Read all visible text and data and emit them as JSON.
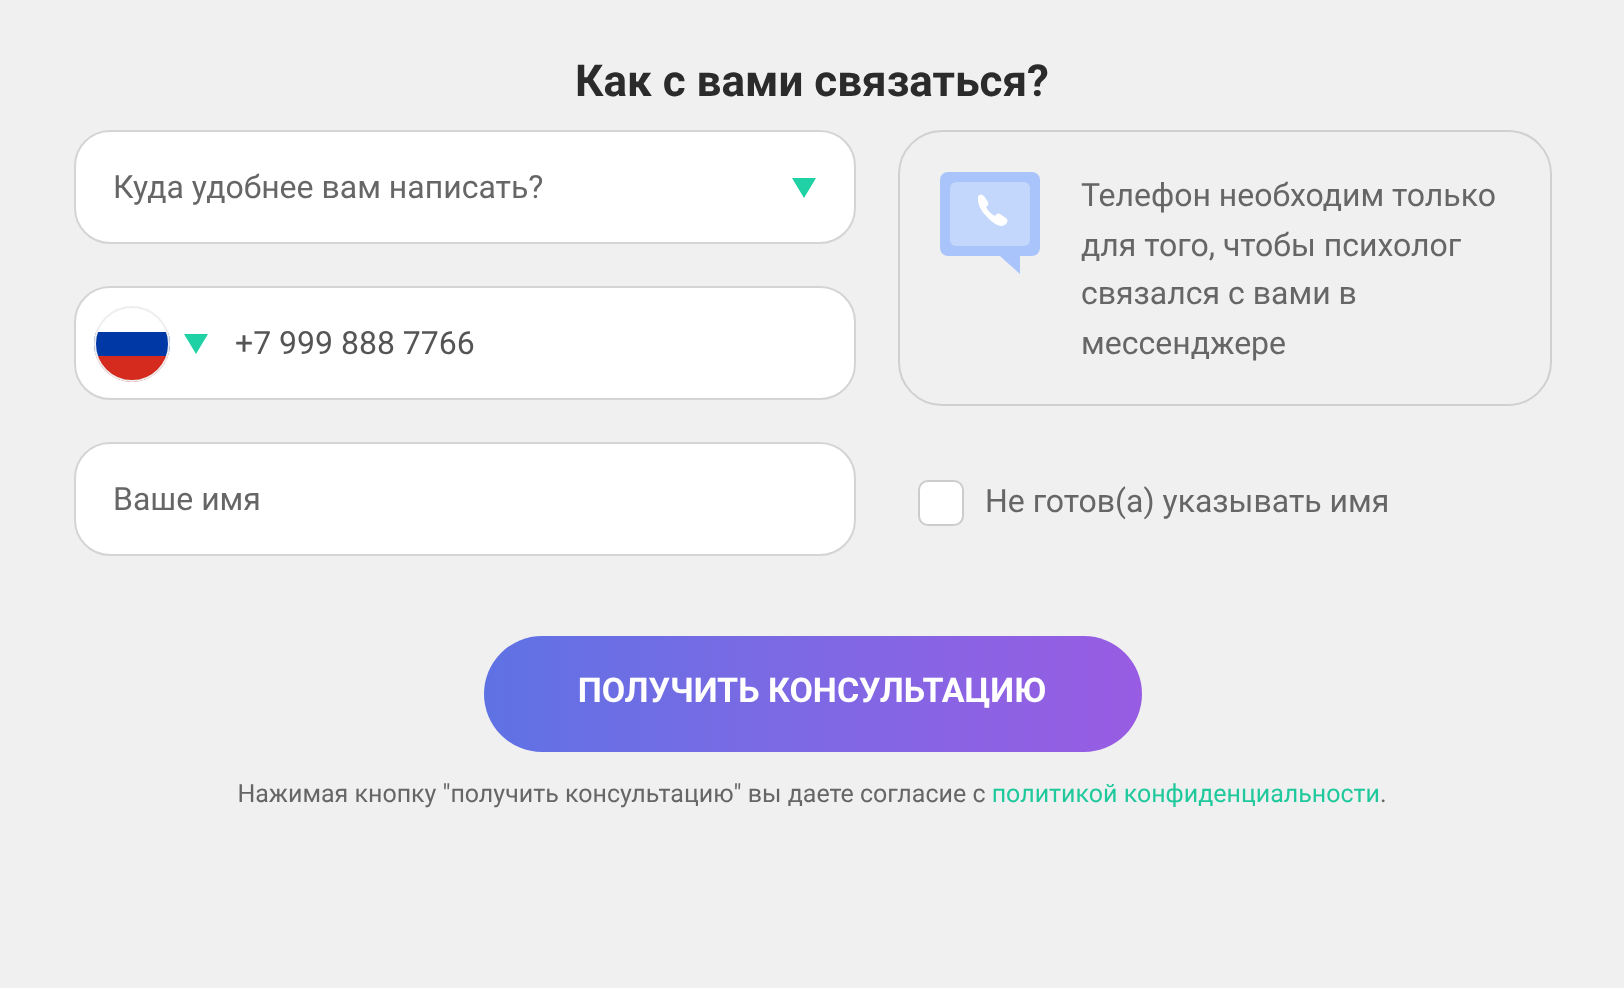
{
  "title": "Как с вами связаться?",
  "messenger_select": {
    "placeholder": "Куда удобнее вам написать?"
  },
  "phone_field": {
    "value": "+7 999 888 7766"
  },
  "name_field": {
    "placeholder": "Ваше имя"
  },
  "info_card": {
    "text": "Телефон необходим только для того, чтобы психолог связался с вами в мессенджере"
  },
  "anonymous_checkbox": {
    "label": "Не готов(а) указывать имя",
    "checked": false
  },
  "submit_button": {
    "label": "ПОЛУЧИТЬ КОНСУЛЬТАЦИЮ"
  },
  "consent": {
    "text": "Нажимая кнопку \"получить консультацию\" вы даете согласие с ",
    "link": "политикой конфиденциальности",
    "end": "."
  }
}
